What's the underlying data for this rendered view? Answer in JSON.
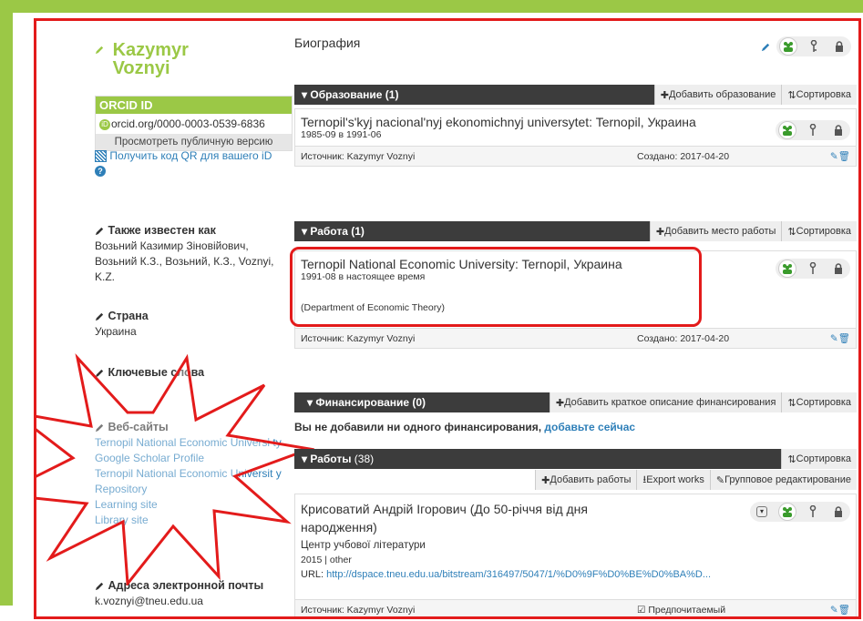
{
  "profile": {
    "name": "Kazymyr\nVoznyi",
    "orcid_label": "ORCID ID",
    "orcid_url": "orcid.org/0000-0003-0539-6836",
    "public_view": "Просмотреть публичную версию",
    "qr_text": "Получить код QR для вашего iD"
  },
  "side": {
    "aka_title": "Также известен как",
    "aka_text": "Возьний Казимир Зіновійович, Возьний К.З., Возьний, К.З., Voznyi, K.Z.",
    "country_title": "Страна",
    "country_text": "Украина",
    "keywords_title": "Ключевые слова",
    "websites_title": "Веб-сайты",
    "websites": [
      "Ternopil National Economic Universi ty",
      "Google Scholar Profile",
      "Ternopil National Economic Universit y Repository",
      "Learning site",
      "Library site"
    ],
    "email_title": "Адреса электронной почты",
    "email": "k.voznyi@tneu.edu.ua"
  },
  "bio": {
    "title": "Биография"
  },
  "education": {
    "title": "Образование (1)",
    "add": "Добавить образование",
    "sort": "Сортировка",
    "item_title": "Ternopil's'kyj nacional'nyj ekonomichnyj universytet: Ternopil, Украина",
    "item_dates": "1985-09 в 1991-06",
    "source": "Источник: Kazymyr Voznyi",
    "created": "Создано: 2017-04-20"
  },
  "employment": {
    "title": "Работа (1)",
    "add": "Добавить место работы",
    "sort": "Сортировка",
    "item_title": "Ternopil National Economic University: Ternopil, Украина",
    "item_dates": "1991-08 в настоящее время",
    "item_dept": "(Department of Economic Theory)",
    "source": "Источник: Kazymyr Voznyi",
    "created": "Создано: 2017-04-20"
  },
  "funding": {
    "title": "Финансирование (0)",
    "add": "Добавить краткое описание финансирования",
    "sort": "Сортировка",
    "empty_text": "Вы не добавили ни одного финансирования, ",
    "empty_link": "добавьте сейчас"
  },
  "works": {
    "title": "Работы",
    "count": "(38)",
    "sort": "Сортировка",
    "add": "Добавить работы",
    "export": "Export works",
    "bulk": "Групповое редактирование",
    "item_title": "Крисоватий Андрій Ігорович (До 50-річчя від дня народження)",
    "item_publisher": "Центр учбової літератури",
    "item_meta": "2015 | other",
    "item_url_label": "URL: ",
    "item_url": "http://dspace.tneu.edu.ua/bitstream/316497/5047/1/%D0%9F%D0%BE%D0%BA%D...",
    "source": "Источник: Kazymyr Voznyi",
    "preferred": "Предпочитаемый"
  },
  "colors": {
    "orcid_green": "#9bc846",
    "highlight_red": "#e31b1b",
    "link_blue": "#2e7fb8",
    "bar_dark": "#3c3c3c"
  }
}
